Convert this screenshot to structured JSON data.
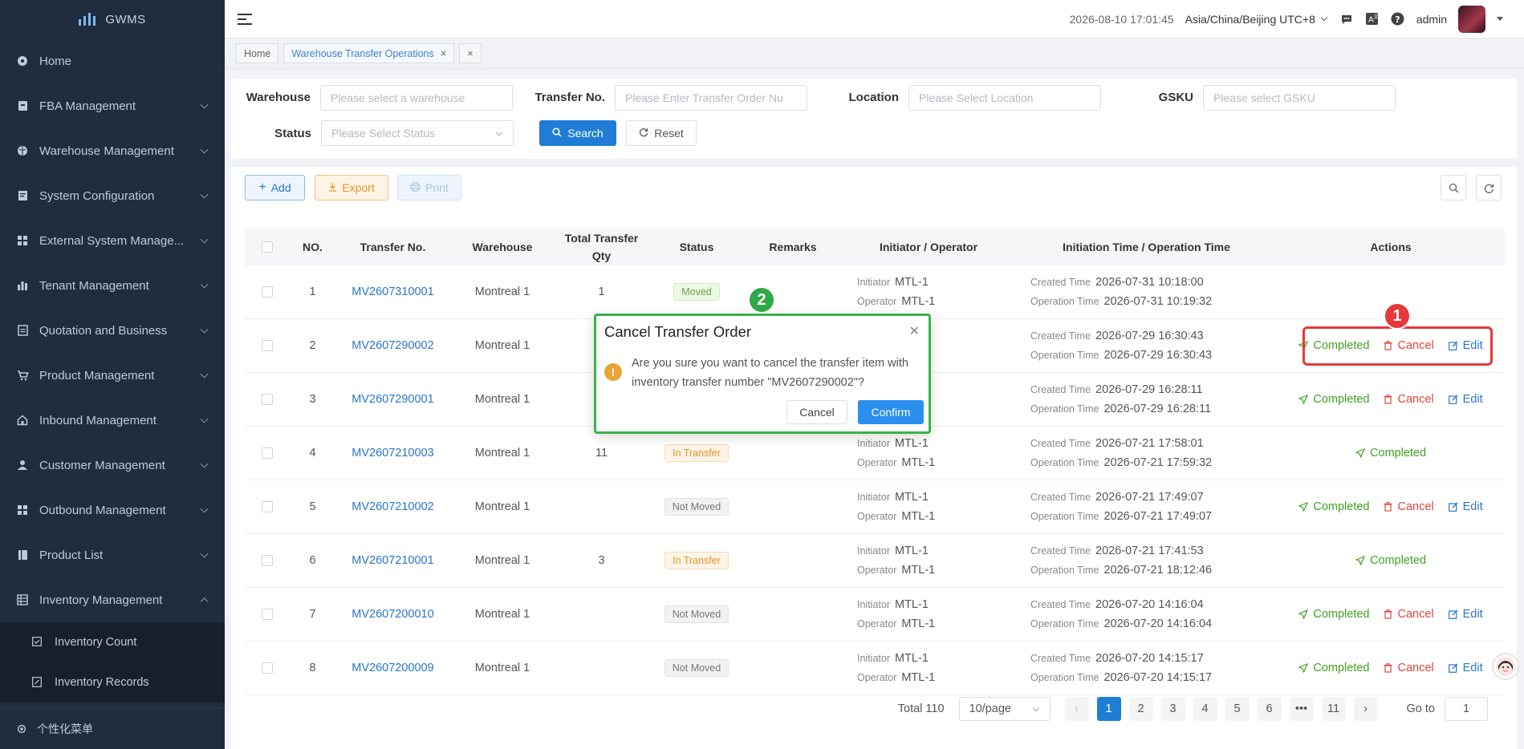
{
  "app": {
    "name": "GWMS"
  },
  "sidebar": {
    "items": [
      {
        "label": "Home",
        "icon": "dashboard-icon",
        "has_children": false
      },
      {
        "label": "FBA Management",
        "icon": "box-icon",
        "has_children": true
      },
      {
        "label": "Warehouse Management",
        "icon": "globe-icon",
        "has_children": true
      },
      {
        "label": "System Configuration",
        "icon": "document-icon",
        "has_children": true
      },
      {
        "label": "External System Manage...",
        "icon": "grid-icon",
        "has_children": true
      },
      {
        "label": "Tenant Management",
        "icon": "bar-chart-icon",
        "has_children": true
      },
      {
        "label": "Quotation and Business",
        "icon": "file-icon",
        "has_children": true
      },
      {
        "label": "Product Management",
        "icon": "cart-icon",
        "has_children": true
      },
      {
        "label": "Inbound Management",
        "icon": "house-icon",
        "has_children": true
      },
      {
        "label": "Customer Management",
        "icon": "user-icon",
        "has_children": true
      },
      {
        "label": "Outbound Management",
        "icon": "grid-icon",
        "has_children": true
      },
      {
        "label": "Product List",
        "icon": "book-icon",
        "has_children": true
      },
      {
        "label": "Inventory Management",
        "icon": "table-icon",
        "has_children": true,
        "expanded": true
      }
    ],
    "subitems": [
      {
        "label": "Inventory Count",
        "icon": "checkbox-icon"
      },
      {
        "label": "Inventory Records",
        "icon": "edit-doc-icon"
      }
    ],
    "footer_label": "个性化菜单"
  },
  "header": {
    "datetime": "2026-08-10 17:01:45",
    "timezone": "Asia/China/Beijing UTC+8",
    "user": "admin"
  },
  "tags": {
    "home": "Home",
    "active": "Warehouse Transfer Operations",
    "close_all": "×"
  },
  "filters": {
    "warehouse_label": "Warehouse",
    "warehouse_placeholder": "Please select a warehouse",
    "transfer_label": "Transfer No.",
    "transfer_placeholder": "Please Enter Transfer Order Nu",
    "location_label": "Location",
    "location_placeholder": "Please Select Location",
    "gsku_label": "GSKU",
    "gsku_placeholder": "Please select GSKU",
    "status_label": "Status",
    "status_placeholder": "Please Select Status",
    "search_label": "Search",
    "reset_label": "Reset"
  },
  "toolbar": {
    "add": "Add",
    "export": "Export",
    "print": "Print"
  },
  "table": {
    "headers": {
      "no": "NO.",
      "transfer_no": "Transfer No.",
      "warehouse": "Warehouse",
      "qty_line1": "Total Transfer",
      "qty_line2": "Qty",
      "status": "Status",
      "remarks": "Remarks",
      "initiator": "Initiator / Operator",
      "time": "Initiation Time / Operation Time",
      "actions": "Actions"
    },
    "labels": {
      "initiator": "Initiator",
      "operator": "Operator",
      "created": "Created Time",
      "operation": "Operation Time"
    },
    "action_labels": {
      "completed": "Completed",
      "cancel": "Cancel",
      "edit": "Edit"
    },
    "rows": [
      {
        "no": "1",
        "transfer_no": "MV2607310001",
        "warehouse": "Montreal 1",
        "qty": "1",
        "status": "Moved",
        "status_kind": "moved",
        "initiator": "MTL-1",
        "operator": "MTL-1",
        "created": "2026-07-31 10:18:00",
        "operation": "2026-07-31 10:19:32",
        "actions": []
      },
      {
        "no": "2",
        "transfer_no": "MV2607290002",
        "warehouse": "Montreal 1",
        "qty": "",
        "status": "",
        "status_kind": "",
        "initiator": "",
        "operator": "",
        "created": "2026-07-29 16:30:43",
        "operation": "2026-07-29 16:30:43",
        "actions": [
          "completed",
          "cancel",
          "edit"
        ]
      },
      {
        "no": "3",
        "transfer_no": "MV2607290001",
        "warehouse": "Montreal 1",
        "qty": "",
        "status": "",
        "status_kind": "",
        "initiator": "",
        "operator": "",
        "created": "2026-07-29 16:28:11",
        "operation": "2026-07-29 16:28:11",
        "actions": [
          "completed",
          "cancel",
          "edit"
        ]
      },
      {
        "no": "4",
        "transfer_no": "MV2607210003",
        "warehouse": "Montreal 1",
        "qty": "11",
        "status": "In Transfer",
        "status_kind": "transfer",
        "initiator": "MTL-1",
        "operator": "MTL-1",
        "created": "2026-07-21 17:58:01",
        "operation": "2026-07-21 17:59:32",
        "actions": [
          "completed"
        ]
      },
      {
        "no": "5",
        "transfer_no": "MV2607210002",
        "warehouse": "Montreal 1",
        "qty": "",
        "status": "Not Moved",
        "status_kind": "notmoved",
        "initiator": "MTL-1",
        "operator": "MTL-1",
        "created": "2026-07-21 17:49:07",
        "operation": "2026-07-21 17:49:07",
        "actions": [
          "completed",
          "cancel",
          "edit"
        ]
      },
      {
        "no": "6",
        "transfer_no": "MV2607210001",
        "warehouse": "Montreal 1",
        "qty": "3",
        "status": "In Transfer",
        "status_kind": "transfer",
        "initiator": "MTL-1",
        "operator": "MTL-1",
        "created": "2026-07-21 17:41:53",
        "operation": "2026-07-21 18:12:46",
        "actions": [
          "completed"
        ]
      },
      {
        "no": "7",
        "transfer_no": "MV2607200010",
        "warehouse": "Montreal 1",
        "qty": "",
        "status": "Not Moved",
        "status_kind": "notmoved",
        "initiator": "MTL-1",
        "operator": "MTL-1",
        "created": "2026-07-20 14:16:04",
        "operation": "2026-07-20 14:16:04",
        "actions": [
          "completed",
          "cancel",
          "edit"
        ]
      },
      {
        "no": "8",
        "transfer_no": "MV2607200009",
        "warehouse": "Montreal 1",
        "qty": "",
        "status": "Not Moved",
        "status_kind": "notmoved",
        "initiator": "MTL-1",
        "operator": "MTL-1",
        "created": "2026-07-20 14:15:17",
        "operation": "2026-07-20 14:15:17",
        "actions": [
          "completed",
          "cancel",
          "edit"
        ]
      }
    ]
  },
  "pagination": {
    "total": "Total 110",
    "page_size": "10/page",
    "pages": [
      "1",
      "2",
      "3",
      "4",
      "5",
      "6",
      "•••",
      "11"
    ],
    "current": "1",
    "goto_label": "Go to",
    "goto_value": "1"
  },
  "dialog": {
    "title": "Cancel Transfer Order",
    "message": "Are you sure you want to cancel the transfer item with inventory transfer number \"MV2607290002\"?",
    "cancel": "Cancel",
    "confirm": "Confirm"
  },
  "annotations": {
    "marker1": "1",
    "marker2": "2"
  },
  "colors": {
    "primary": "#1f7dd6",
    "sidebar": "#1f2d3d",
    "success": "#3fa31f",
    "danger": "#e0453d",
    "warning": "#e6952e",
    "highlight_red": "#e8393a",
    "highlight_green": "#2fa84a"
  }
}
